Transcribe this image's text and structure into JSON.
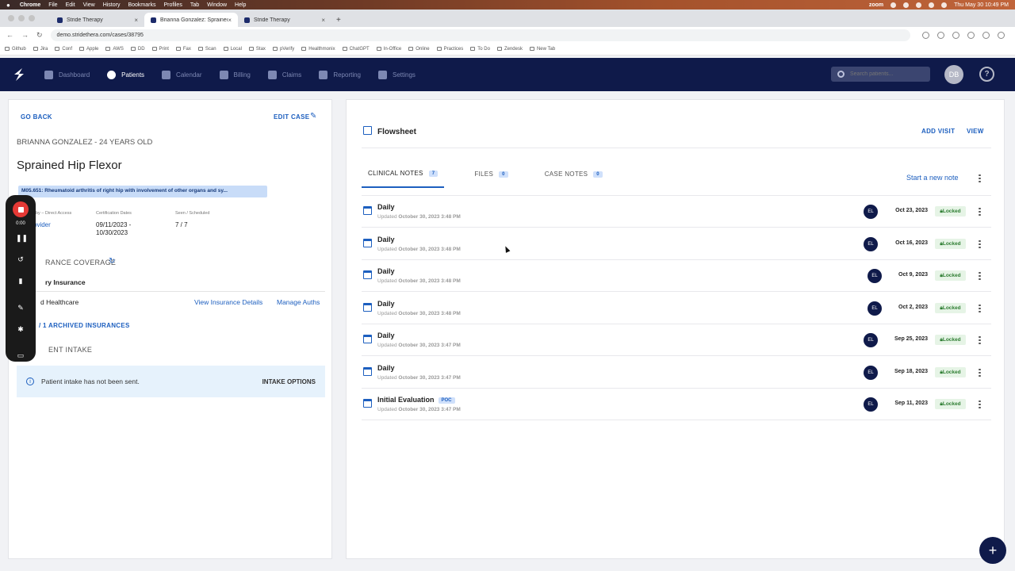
{
  "menubar": {
    "app": "Chrome",
    "items": [
      "File",
      "Edit",
      "View",
      "History",
      "Bookmarks",
      "Profiles",
      "Tab",
      "Window",
      "Help"
    ],
    "zoom": "zoom",
    "datetime": "Thu May 30  10:49 PM"
  },
  "browser": {
    "tabs": [
      {
        "title": "Stride Therapy",
        "active": false
      },
      {
        "title": "Brianna Gonzalez: Sprained H",
        "active": true
      },
      {
        "title": "Stride Therapy",
        "active": false
      }
    ],
    "url": "demo.stridethera.com/cases/38795",
    "bookmarks": [
      "Github",
      "Jira",
      "Conf",
      "Apple",
      "AWS",
      "DD",
      "Print",
      "Fax",
      "Scan",
      "Local",
      "Stax",
      "pVerify",
      "Healthmonix",
      "ChatGPT",
      "In-Office",
      "Online",
      "Practices",
      "To Do",
      "Zendesk",
      "New Tab"
    ]
  },
  "appnav": {
    "items": [
      {
        "label": "Dashboard",
        "active": false
      },
      {
        "label": "Patients",
        "active": true
      },
      {
        "label": "Calendar",
        "active": false
      },
      {
        "label": "Billing",
        "active": false
      },
      {
        "label": "Claims",
        "active": false
      },
      {
        "label": "Reporting",
        "active": false
      },
      {
        "label": "Settings",
        "active": false
      }
    ],
    "search_placeholder": "Search patients...",
    "avatar": "DB",
    "help": "?"
  },
  "case": {
    "go_back": "GO BACK",
    "edit_case": "EDIT CASE",
    "patient": "BRIANNA GONZALEZ - 24 YEARS OLD",
    "title": "Sprained Hip Flexor",
    "diagnosis": "M05.651: Rheumatoid arthritis of right hip with involvement of other organs and sy...",
    "referred_label": "by – Direct Access",
    "referred_value": "ovider",
    "cert_label": "Certification Dates",
    "cert_value_1": "09/11/2023 -",
    "cert_value_2": "10/30/2023",
    "seen_label": "Seen / Scheduled",
    "seen_value": "7 / 7",
    "insurance_heading": "RANCE COVERAGE",
    "primary_label": "ry Insurance",
    "insurer": "d Healthcare",
    "view_ins": "View Insurance Details",
    "manage_auths": "Manage Auths",
    "archived": "/ 1 ARCHIVED INSURANCES",
    "intake_heading": "ENT INTAKE",
    "intake_msg": "Patient intake has not been sent.",
    "intake_options": "INTAKE OPTIONS"
  },
  "recorder": {
    "time": "0:00"
  },
  "flowsheet": {
    "title": "Flowsheet",
    "add_visit": "ADD VISIT",
    "view": "VIEW",
    "tabs": [
      {
        "label": "CLINICAL NOTES",
        "count": "7",
        "active": true
      },
      {
        "label": "FILES",
        "count": "0",
        "active": false
      },
      {
        "label": "CASE NOTES",
        "count": "0",
        "active": false
      }
    ],
    "start_note": "Start a new note",
    "updated_prefix": "Updated",
    "locked": "Locked",
    "poc": "POC",
    "notes": [
      {
        "title": "Daily",
        "updated": "October 30, 2023 3:48 PM",
        "initials": "EL",
        "date": "Oct 23, 2023"
      },
      {
        "title": "Daily",
        "updated": "October 30, 2023 3:48 PM",
        "initials": "EL",
        "date": "Oct 16, 2023"
      },
      {
        "title": "Daily",
        "updated": "October 30, 2023 3:48 PM",
        "initials": "EL",
        "date": "Oct 9, 2023"
      },
      {
        "title": "Daily",
        "updated": "October 30, 2023 3:48 PM",
        "initials": "EL",
        "date": "Oct 2, 2023"
      },
      {
        "title": "Daily",
        "updated": "October 30, 2023 3:47 PM",
        "initials": "EL",
        "date": "Sep 25, 2023"
      },
      {
        "title": "Daily",
        "updated": "October 30, 2023 3:47 PM",
        "initials": "EL",
        "date": "Sep 18, 2023"
      },
      {
        "title": "Initial Evaluation",
        "updated": "October 30, 2023 3:47 PM",
        "initials": "EL",
        "date": "Sep 11, 2023"
      }
    ]
  },
  "fab": "+"
}
